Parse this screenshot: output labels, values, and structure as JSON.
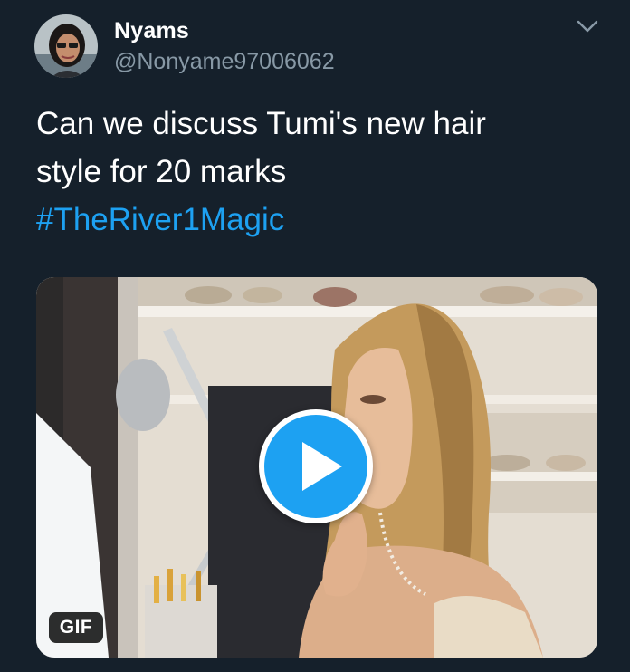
{
  "tweet": {
    "user": {
      "name": "Nyams",
      "handle": "@Nonyame97006062",
      "avatar_icon": "user-avatar"
    },
    "menu_icon": "chevron-down-icon",
    "text_lines": [
      "Can we discuss Tumi's new hair",
      "style for 20 marks"
    ],
    "hashtag": "#TheRiver1Magic",
    "media": {
      "type": "gif",
      "badge": "GIF",
      "play_icon": "play-icon"
    }
  },
  "colors": {
    "background": "#15202b",
    "text": "#ffffff",
    "secondary_text": "#8899a6",
    "accent": "#1da1f2"
  }
}
